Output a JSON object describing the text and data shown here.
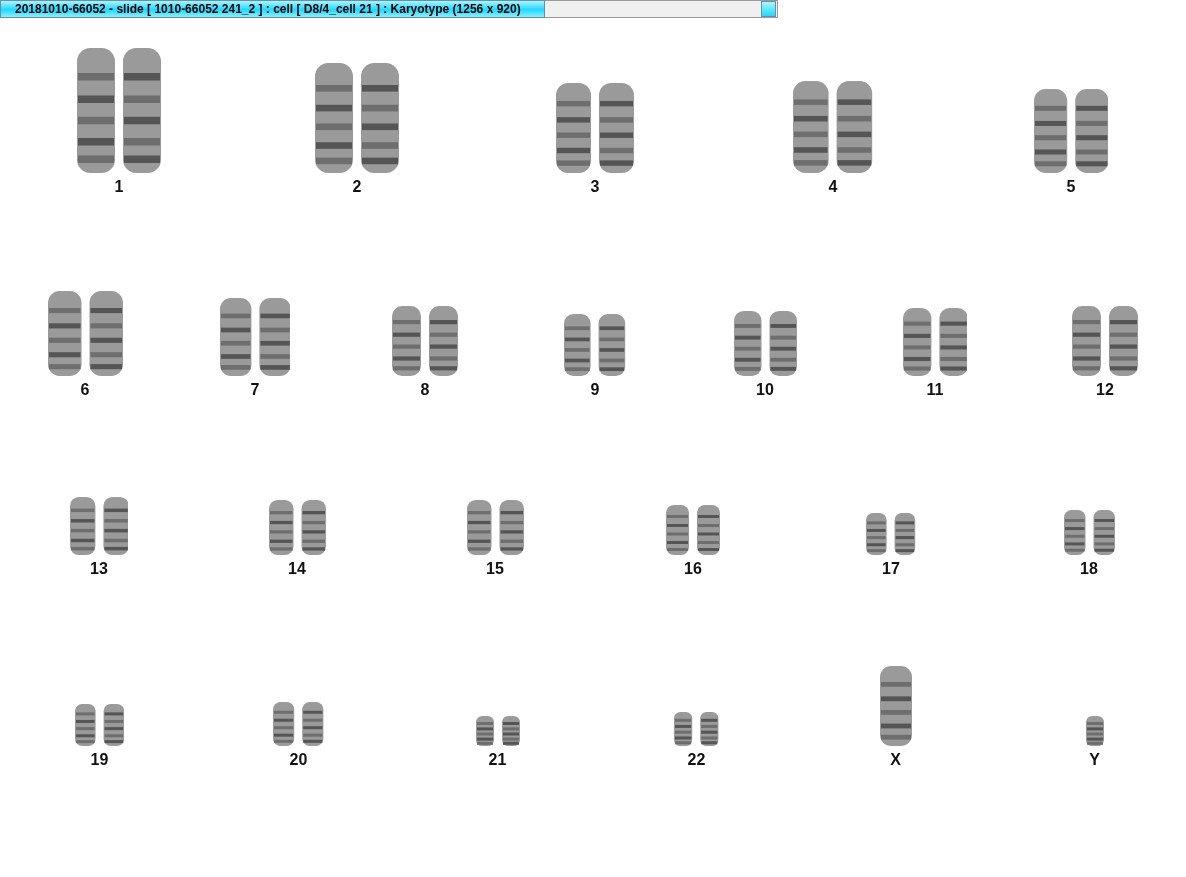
{
  "window": {
    "title": "20181010-66052 - slide [ 1010-66052 241_2 ] : cell [ D8/4_cell 21 ] : Karyotype  (1256 x 920)"
  },
  "karyotype": {
    "rows": [
      {
        "items": [
          {
            "label": "1",
            "kind": "pair"
          },
          {
            "label": "2",
            "kind": "pair"
          },
          {
            "label": "3",
            "kind": "pair"
          },
          {
            "label": "4",
            "kind": "pair"
          },
          {
            "label": "5",
            "kind": "pair"
          }
        ]
      },
      {
        "items": [
          {
            "label": "6",
            "kind": "pair"
          },
          {
            "label": "7",
            "kind": "pair"
          },
          {
            "label": "8",
            "kind": "pair"
          },
          {
            "label": "9",
            "kind": "pair"
          },
          {
            "label": "10",
            "kind": "pair"
          },
          {
            "label": "11",
            "kind": "pair"
          },
          {
            "label": "12",
            "kind": "pair"
          }
        ]
      },
      {
        "items": [
          {
            "label": "13",
            "kind": "pair"
          },
          {
            "label": "14",
            "kind": "pair"
          },
          {
            "label": "15",
            "kind": "pair"
          },
          {
            "label": "16",
            "kind": "pair"
          },
          {
            "label": "17",
            "kind": "pair"
          },
          {
            "label": "18",
            "kind": "pair"
          }
        ]
      },
      {
        "items": [
          {
            "label": "19",
            "kind": "pair"
          },
          {
            "label": "20",
            "kind": "pair"
          },
          {
            "label": "21",
            "kind": "pair"
          },
          {
            "label": "22",
            "kind": "pair"
          },
          {
            "label": "X",
            "kind": "single"
          },
          {
            "label": "Y",
            "kind": "single"
          }
        ]
      }
    ]
  }
}
